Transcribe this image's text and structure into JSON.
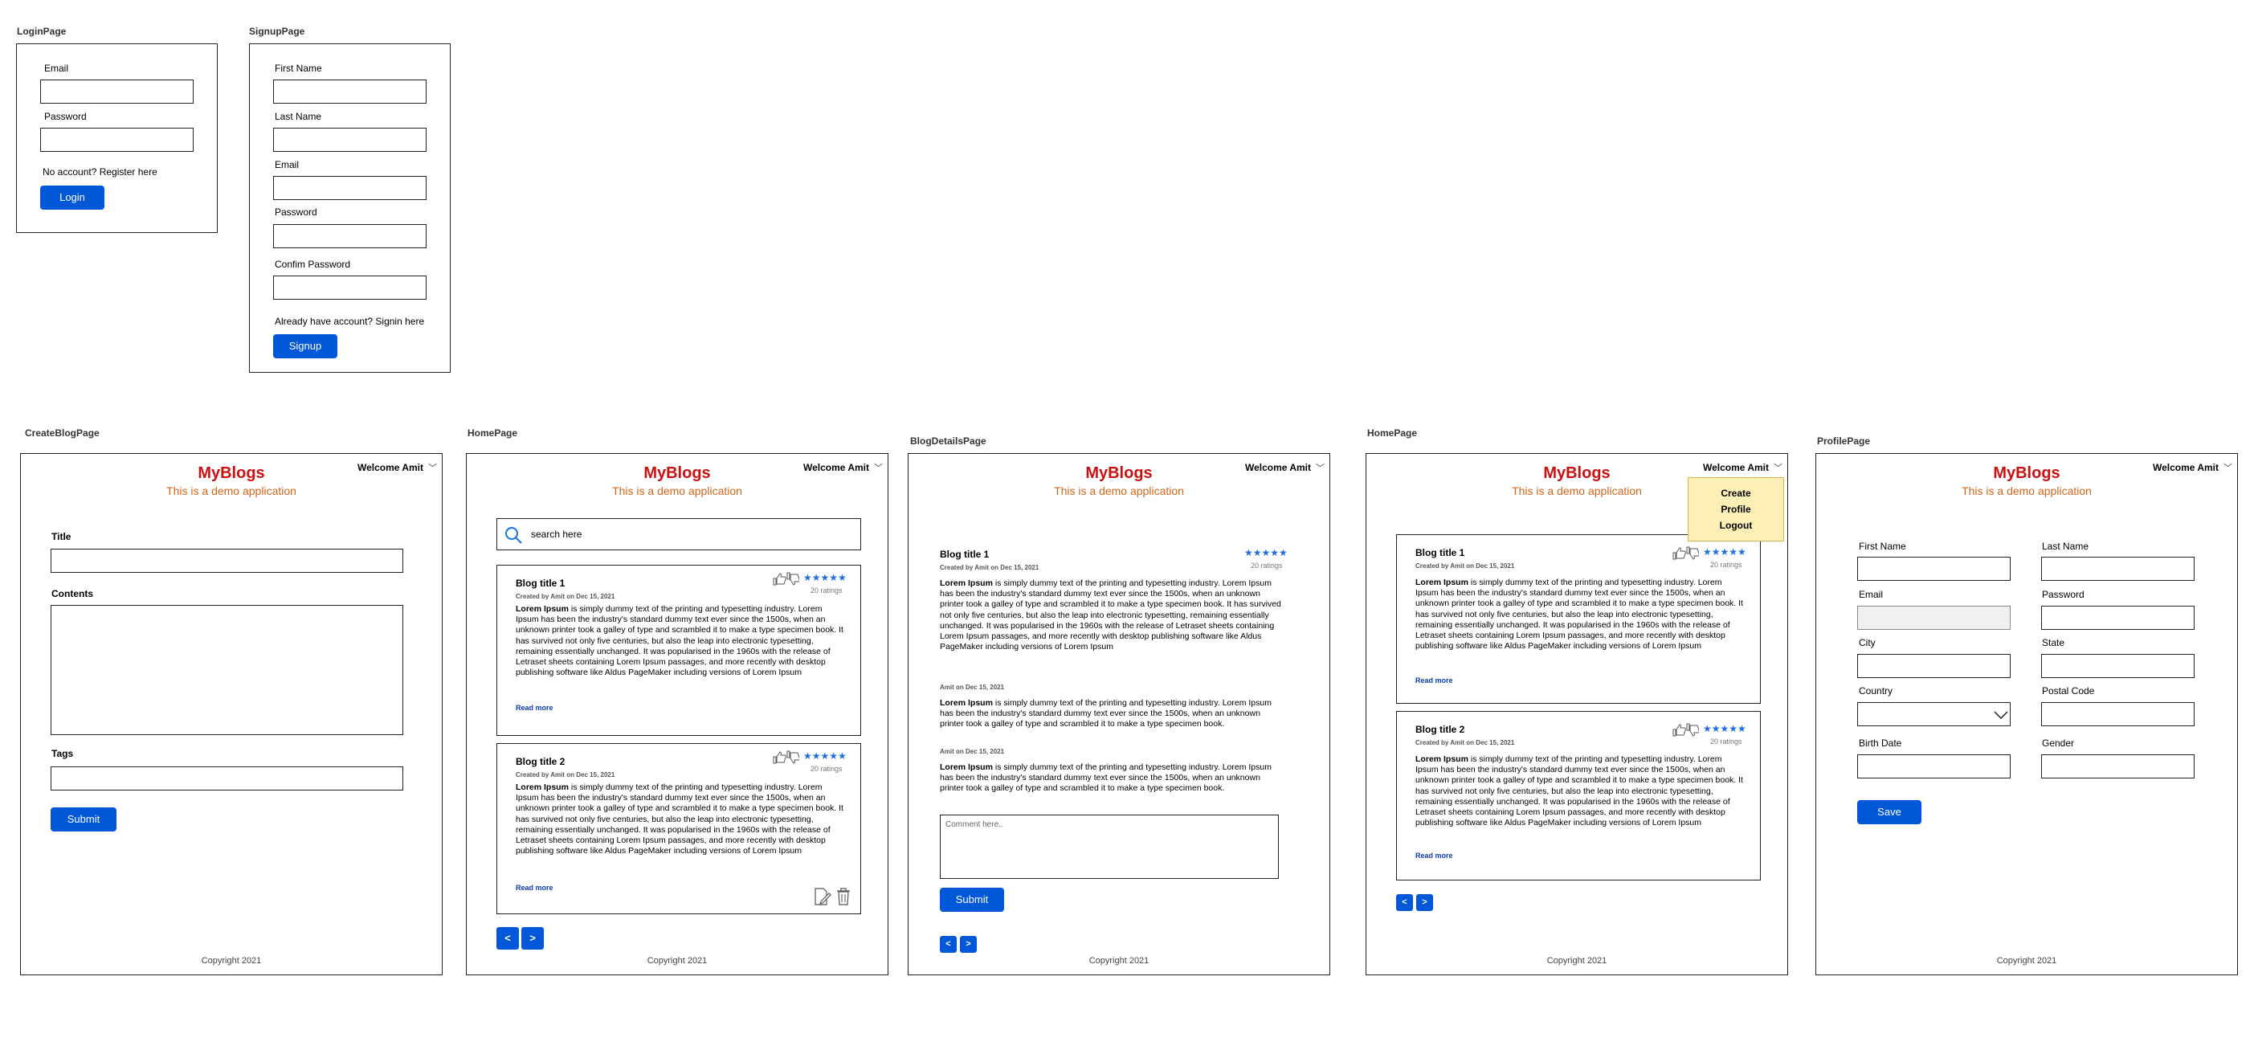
{
  "labels": {
    "login": "LoginPage",
    "signup": "SignupPage",
    "create": "CreateBlogPage",
    "home": "HomePage",
    "details": "BlogDetailsPage",
    "home2": "HomePage",
    "profile": "ProfilePage"
  },
  "login": {
    "email_label": "Email",
    "password_label": "Password",
    "register_text": "No account? Register here",
    "login_button": "Login"
  },
  "signup": {
    "first_name_label": "First Name",
    "last_name_label": "Last Name",
    "email_label": "Email",
    "password_label": "Password",
    "confirm_label": "Confim Password",
    "signin_text": "Already have account? Signin here",
    "signup_button": "Signup"
  },
  "app": {
    "brand": "MyBlogs",
    "tagline": "This is a demo application",
    "welcome": "Welcome Amit",
    "copyright": "Copyright 2021",
    "brand_color": "#cc1010",
    "tagline_color": "#d0661a",
    "accent": "#0057d8"
  },
  "create": {
    "title_label": "Title",
    "contents_label": "Contents",
    "tags_label": "Tags",
    "submit_button": "Submit"
  },
  "home": {
    "search_placeholder": "search here",
    "prev": "<",
    "next": ">"
  },
  "blog": {
    "title1": "Blog title 1",
    "title2": "Blog title 2",
    "byline": "Created by Amit on Dec 15, 2021",
    "stars": "★★★★★",
    "ratings": "20 ratings",
    "lorem_bold": "Lorem Ipsum",
    "lorem_rest": " is simply dummy text of the printing and typesetting industry. Lorem Ipsum has been the industry's standard dummy text ever since the 1500s, when an unknown printer took a galley of type and scrambled it to make a type specimen book. It has survived not only five centuries, but also the leap into electronic typesetting, remaining essentially unchanged. It was popularised in the 1960s with the release of Letraset sheets containing Lorem Ipsum passages, and more recently with desktop publishing software like Aldus PageMaker including versions of Lorem Ipsum",
    "read_more": "Read more"
  },
  "details": {
    "title": "Blog title 1",
    "byline": "Created by Amit on Dec 15, 2021",
    "body_rest": " is simply dummy text of the printing and typesetting industry. Lorem Ipsum has been the industry's standard dummy text ever since the 1500s, when an unknown printer took a galley of type and scrambled it to make a type specimen book. It has survived not only five centuries, but also the leap into electronic typesetting, remaining essentially unchanged. It was popularised in the 1960s with the release of Letraset sheets containing Lorem Ipsum passages, and more recently with desktop publishing software like Aldus PageMaker including versions of Lorem Ipsum",
    "comment_by": "Amit on Dec 15, 2021",
    "comment_rest": " is simply dummy text of the printing and typesetting industry. Lorem Ipsum has been the industry's standard dummy text ever since the 1500s, when an unknown printer took a galley of type and scrambled it to make a type specimen book.",
    "comment_placeholder": "Comment here..",
    "submit_button": "Submit"
  },
  "menu": {
    "create": "Create",
    "profile": "Profile",
    "logout": "Logout"
  },
  "profile": {
    "first_name_label": "First Name",
    "last_name_label": "Last Name",
    "email_label": "Email",
    "password_label": "Password",
    "city_label": "City",
    "state_label": "State",
    "country_label": "Country",
    "postal_label": "Postal Code",
    "birth_label": "Birth Date",
    "gender_label": "Gender",
    "save_button": "Save"
  }
}
